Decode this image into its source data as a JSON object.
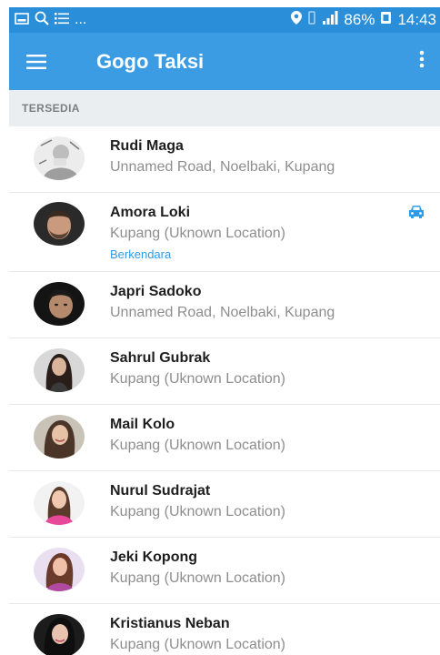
{
  "status_bar": {
    "left_icons": [
      "image-icon",
      "search-icon",
      "list-icon"
    ],
    "ellipsis": "...",
    "battery": "86%",
    "time": "14:43"
  },
  "app_bar": {
    "title": "Gogo Taksi"
  },
  "section": {
    "header": "TERSEDIA"
  },
  "drivers": [
    {
      "name": "Rudi Maga",
      "location": "Unnamed Road, Noelbaki, Kupang",
      "status": "",
      "avatar": "sketch"
    },
    {
      "name": "Amora Loki",
      "location": "Kupang (Uknown Location)",
      "status": "Berkendara",
      "avatar": "man-beard"
    },
    {
      "name": "Japri Sadoko",
      "location": "Unnamed Road, Noelbaki, Kupang",
      "status": "",
      "avatar": "man-dark"
    },
    {
      "name": "Sahrul Gubrak",
      "location": "Kupang (Uknown Location)",
      "status": "",
      "avatar": "woman-dark-hair"
    },
    {
      "name": "Mail Kolo",
      "location": "Kupang (Uknown Location)",
      "status": "",
      "avatar": "woman-smile"
    },
    {
      "name": "Nurul Sudrajat",
      "location": "Kupang (Uknown Location)",
      "status": "",
      "avatar": "woman-pink"
    },
    {
      "name": "Jeki Kopong",
      "location": "Kupang (Uknown Location)",
      "status": "",
      "avatar": "woman-purple"
    },
    {
      "name": "Kristianus Neban",
      "location": "Kupang (Uknown Location)",
      "status": "",
      "avatar": "woman-portrait"
    }
  ],
  "colors": {
    "status_bar": "#2a8fd8",
    "app_bar": "#3b9be3",
    "section_bg": "#eaeef1",
    "accent": "#2e9be6"
  }
}
